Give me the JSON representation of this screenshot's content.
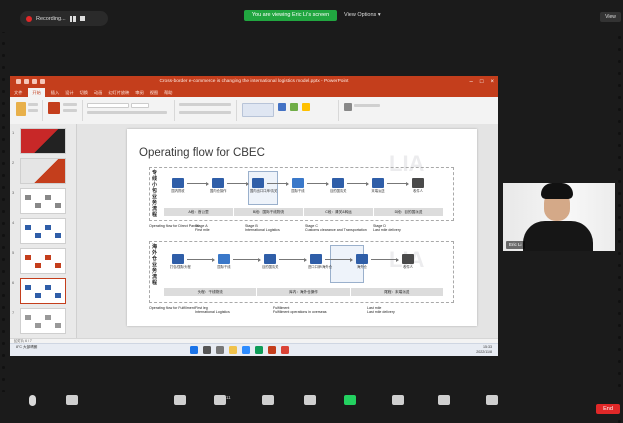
{
  "zoom": {
    "recording_label": "Recording...",
    "viewing_banner": "You are viewing Eric Li's screen",
    "view_options_label": "View Options ▾",
    "view_button": "View",
    "participant_name": "Eric Li",
    "end_button": "End",
    "participants_count": "11"
  },
  "powerpoint": {
    "window_title": "Cross-border e-commerce is changing the international logistics model.pptx - PowerPoint",
    "active_tab": "开始",
    "tabs": [
      "文件",
      "开始",
      "插入",
      "设计",
      "切换",
      "动画",
      "幻灯片放映",
      "审阅",
      "视图",
      "帮助"
    ],
    "slide_numbers": [
      "1",
      "2",
      "3",
      "4",
      "5",
      "6",
      "7"
    ],
    "status_text": "幻灯片 6 / 7",
    "colors": {
      "ribbon_accent": "#c43e1c",
      "diagram_blue": "#2f5ea8"
    }
  },
  "slide": {
    "title": "Operating flow for CBEC",
    "lane1_label": "专线小包业务流程",
    "lane2_label": "海外仓业务流程",
    "lane1_nodes": [
      "国内揽收",
      "国内仓操作",
      "国内出口口岸/清关",
      "国际干线",
      "目的国清关",
      "末端派送",
      "收件人"
    ],
    "lane2_nodes": [
      "打包/国际头程",
      "国际干线",
      "目的国清关",
      "进口口岸/海外仓",
      "海外仓",
      "收件人"
    ],
    "lane1_stages": [
      "A段：首公里",
      "B段：国际干线物流",
      "C段：清关&转运",
      "D段：目的国派送"
    ],
    "lane2_stages": [
      "头程：干线物流",
      "库内：海外仓操作",
      "尾程：末端派送"
    ],
    "lane1_caption": "Operating flow for Direct Parcel",
    "lane2_caption": "Operating flow for Fulfillment",
    "lane1_notes": [
      "Stage A\nFirst mile",
      "Stage B\nInternational Logistics",
      "Stage C\nCustoms clearance and Transportation",
      "Stage D\nLast mile delivery"
    ],
    "lane2_notes": [
      "First leg\nInternational Logistics",
      "Fulfillment\nFulfillment operations in overseas",
      "Last mile\nLast mile delivery"
    ]
  },
  "taskbar": {
    "weather": "8°C 大部晴朗",
    "clock_time": "15:33",
    "clock_date": "2022/11/8"
  },
  "controls": [
    "Unmute",
    "Start Video",
    "Security",
    "Participants",
    "Polls",
    "Chat",
    "Share Screen",
    "Record",
    "Breakout Rooms",
    "Reactions"
  ]
}
